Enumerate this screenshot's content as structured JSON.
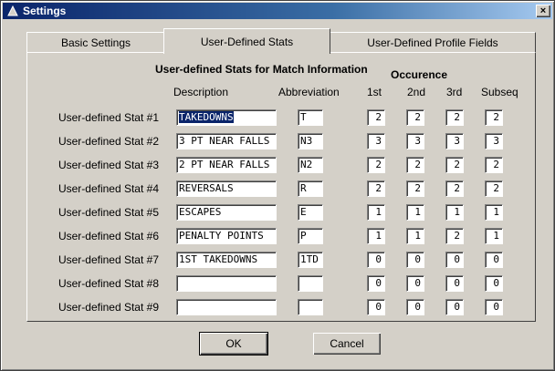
{
  "window": {
    "title": "Settings",
    "close_label": "×"
  },
  "tabs": [
    {
      "label": "Basic Settings",
      "active": false
    },
    {
      "label": "User-Defined Stats",
      "active": true
    },
    {
      "label": "User-Defined Profile Fields",
      "active": false
    }
  ],
  "panel": {
    "heading": "User-defined Stats for Match Information",
    "occurence_label": "Occurence",
    "col_description": "Description",
    "col_abbreviation": "Abbreviation",
    "col_1st": "1st",
    "col_2nd": "2nd",
    "col_3rd": "3rd",
    "col_subseq": "Subseq"
  },
  "stats": [
    {
      "label": "User-defined Stat #1",
      "description": "TAKEDOWNS",
      "abbreviation": "T",
      "first": "2",
      "second": "2",
      "third": "2",
      "subseq": "2",
      "selected": true
    },
    {
      "label": "User-defined Stat #2",
      "description": "3 PT NEAR FALLS",
      "abbreviation": "N3",
      "first": "3",
      "second": "3",
      "third": "3",
      "subseq": "3"
    },
    {
      "label": "User-defined Stat #3",
      "description": "2 PT NEAR FALLS",
      "abbreviation": "N2",
      "first": "2",
      "second": "2",
      "third": "2",
      "subseq": "2"
    },
    {
      "label": "User-defined Stat #4",
      "description": "REVERSALS",
      "abbreviation": "R",
      "first": "2",
      "second": "2",
      "third": "2",
      "subseq": "2"
    },
    {
      "label": "User-defined Stat #5",
      "description": "ESCAPES",
      "abbreviation": "E",
      "first": "1",
      "second": "1",
      "third": "1",
      "subseq": "1"
    },
    {
      "label": "User-defined Stat #6",
      "description": "PENALTY POINTS",
      "abbreviation": "P",
      "first": "1",
      "second": "1",
      "third": "2",
      "subseq": "1"
    },
    {
      "label": "User-defined Stat #7",
      "description": "1ST TAKEDOWNS",
      "abbreviation": "1TD",
      "first": "0",
      "second": "0",
      "third": "0",
      "subseq": "0"
    },
    {
      "label": "User-defined Stat #8",
      "description": "",
      "abbreviation": "",
      "first": "0",
      "second": "0",
      "third": "0",
      "subseq": "0"
    },
    {
      "label": "User-defined Stat #9",
      "description": "",
      "abbreviation": "",
      "first": "0",
      "second": "0",
      "third": "0",
      "subseq": "0"
    }
  ],
  "buttons": {
    "ok": "OK",
    "cancel": "Cancel"
  },
  "colors": {
    "titlebar": "#0a246a",
    "face": "#d4d0c8",
    "selection": "#0a246a"
  },
  "icons": {
    "title": "app-settings-icon",
    "close": "close-icon"
  }
}
